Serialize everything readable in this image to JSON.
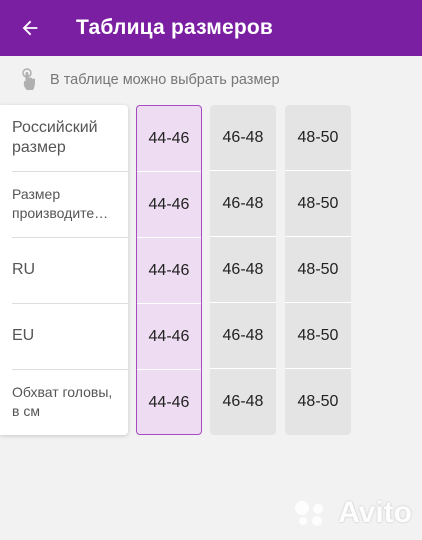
{
  "header": {
    "title": "Таблица размеров"
  },
  "hint": {
    "text": "В таблице можно выбрать размер"
  },
  "table": {
    "row_labels": [
      "Российский размер",
      "Размер производите…",
      "RU",
      "EU",
      "Обхват головы, в см"
    ],
    "columns": [
      {
        "selected": true,
        "values": [
          "44-46",
          "44-46",
          "44-46",
          "44-46",
          "44-46"
        ]
      },
      {
        "selected": false,
        "values": [
          "46-48",
          "46-48",
          "46-48",
          "46-48",
          "46-48"
        ]
      },
      {
        "selected": false,
        "values": [
          "48-50",
          "48-50",
          "48-50",
          "48-50",
          "48-50"
        ]
      }
    ]
  },
  "watermark": {
    "text": "Avito"
  },
  "colors": {
    "app_bar": "#7b1fa2",
    "selected_fill": "#eedcf2",
    "selected_border": "#a64cc0",
    "unselected_fill": "#e4e4e4"
  },
  "icons": {
    "back": "arrow-left",
    "hint": "tap-hand"
  }
}
